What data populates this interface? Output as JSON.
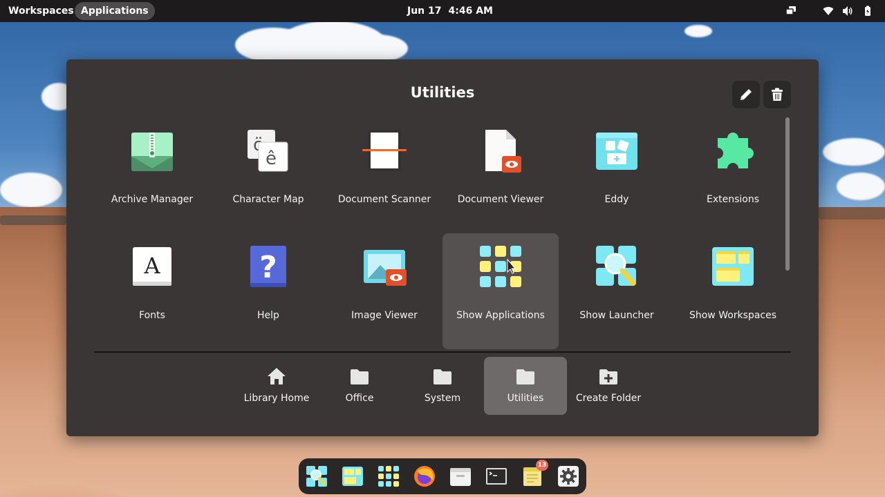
{
  "top_panel": {
    "workspaces_label": "Workspaces",
    "applications_label": "Applications",
    "date": "Jun 17",
    "time": "4:46 AM"
  },
  "launcher": {
    "title": "Utilities",
    "header_buttons": [
      {
        "icon": "pencil-icon",
        "action": "edit"
      },
      {
        "icon": "trash-icon",
        "action": "delete"
      }
    ],
    "apps": [
      {
        "label": "Archive Manager",
        "icon": "archive-manager-icon"
      },
      {
        "label": "Character Map",
        "icon": "character-map-icon"
      },
      {
        "label": "Document Scanner",
        "icon": "document-scanner-icon"
      },
      {
        "label": "Document Viewer",
        "icon": "document-viewer-icon"
      },
      {
        "label": "Eddy",
        "icon": "eddy-icon"
      },
      {
        "label": "Extensions",
        "icon": "extensions-icon"
      },
      {
        "label": "Fonts",
        "icon": "fonts-icon"
      },
      {
        "label": "Help",
        "icon": "help-icon"
      },
      {
        "label": "Image Viewer",
        "icon": "image-viewer-icon"
      },
      {
        "label": "Show Applications",
        "icon": "show-applications-icon",
        "hovered": true
      },
      {
        "label": "Show Launcher",
        "icon": "show-launcher-icon"
      },
      {
        "label": "Show Workspaces",
        "icon": "show-workspaces-icon"
      }
    ],
    "folders": [
      {
        "label": "Library Home",
        "icon": "home-icon"
      },
      {
        "label": "Office",
        "icon": "folder-icon"
      },
      {
        "label": "System",
        "icon": "folder-icon"
      },
      {
        "label": "Utilities",
        "icon": "folder-icon",
        "selected": true
      },
      {
        "label": "Create Folder",
        "icon": "folder-plus-icon"
      }
    ]
  },
  "dock": {
    "items": [
      {
        "name": "launcher-icon"
      },
      {
        "name": "workspaces-icon"
      },
      {
        "name": "applications-grid-icon"
      },
      {
        "name": "firefox-icon"
      },
      {
        "name": "files-icon"
      },
      {
        "name": "terminal-icon"
      },
      {
        "name": "notes-icon",
        "badge": "13"
      },
      {
        "name": "settings-icon"
      }
    ]
  },
  "colors": {
    "panel": "#1d1b1b",
    "launcher_bg": "#3b3636",
    "hover_tile": "#565151",
    "selected_folder": "#6f6a6a",
    "accent_cyan": "#7cecf5",
    "accent_yellow": "#fff27a"
  }
}
